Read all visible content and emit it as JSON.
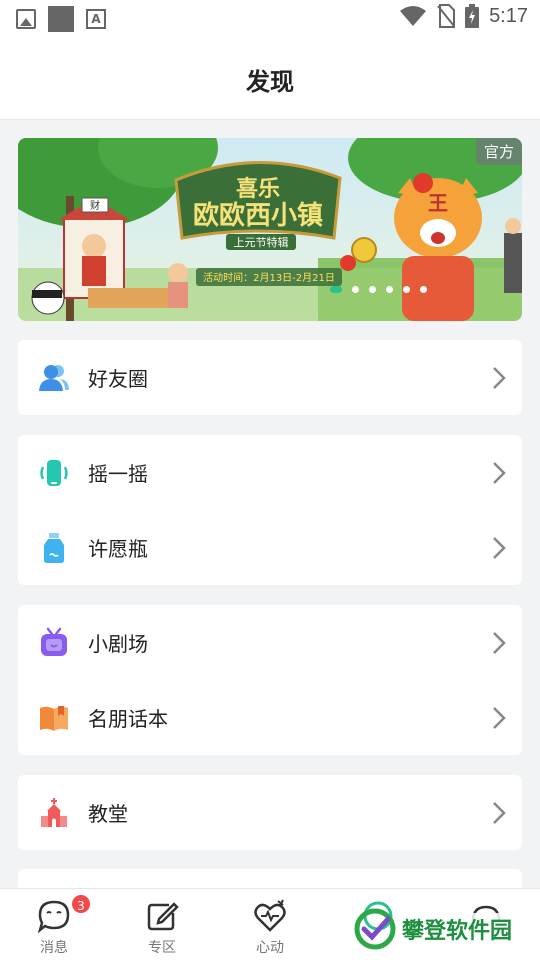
{
  "status_bar": {
    "time": "5:17"
  },
  "header": {
    "title": "发现"
  },
  "banner": {
    "badge": "官方",
    "title_line1": "喜乐",
    "title_line2": "欧欧西小镇",
    "subtitle": "上元节特辑",
    "activity_time": "活动时间：2月13日-2月21日",
    "sign_text": "财",
    "slides": 6,
    "active_slide": 0
  },
  "menu_groups": [
    {
      "items": [
        {
          "label": "好友圈",
          "icon": "friends-circle-icon"
        }
      ]
    },
    {
      "items": [
        {
          "label": "摇一摇",
          "icon": "shake-icon"
        },
        {
          "label": "许愿瓶",
          "icon": "wish-bottle-icon"
        }
      ]
    },
    {
      "items": [
        {
          "label": "小剧场",
          "icon": "theater-tv-icon"
        },
        {
          "label": "名朋话本",
          "icon": "book-icon"
        }
      ]
    },
    {
      "items": [
        {
          "label": "教堂",
          "icon": "church-icon"
        }
      ]
    }
  ],
  "tab_bar": {
    "tabs": [
      {
        "label": "消息",
        "icon": "message-icon",
        "badge": "3"
      },
      {
        "label": "专区",
        "icon": "edit-zone-icon"
      },
      {
        "label": "心动",
        "icon": "heartbeat-icon"
      }
    ]
  },
  "watermark": {
    "text": "攀登软件园"
  },
  "colors": {
    "accent": "#2cc08f",
    "badge_red": "#f24a4a"
  }
}
